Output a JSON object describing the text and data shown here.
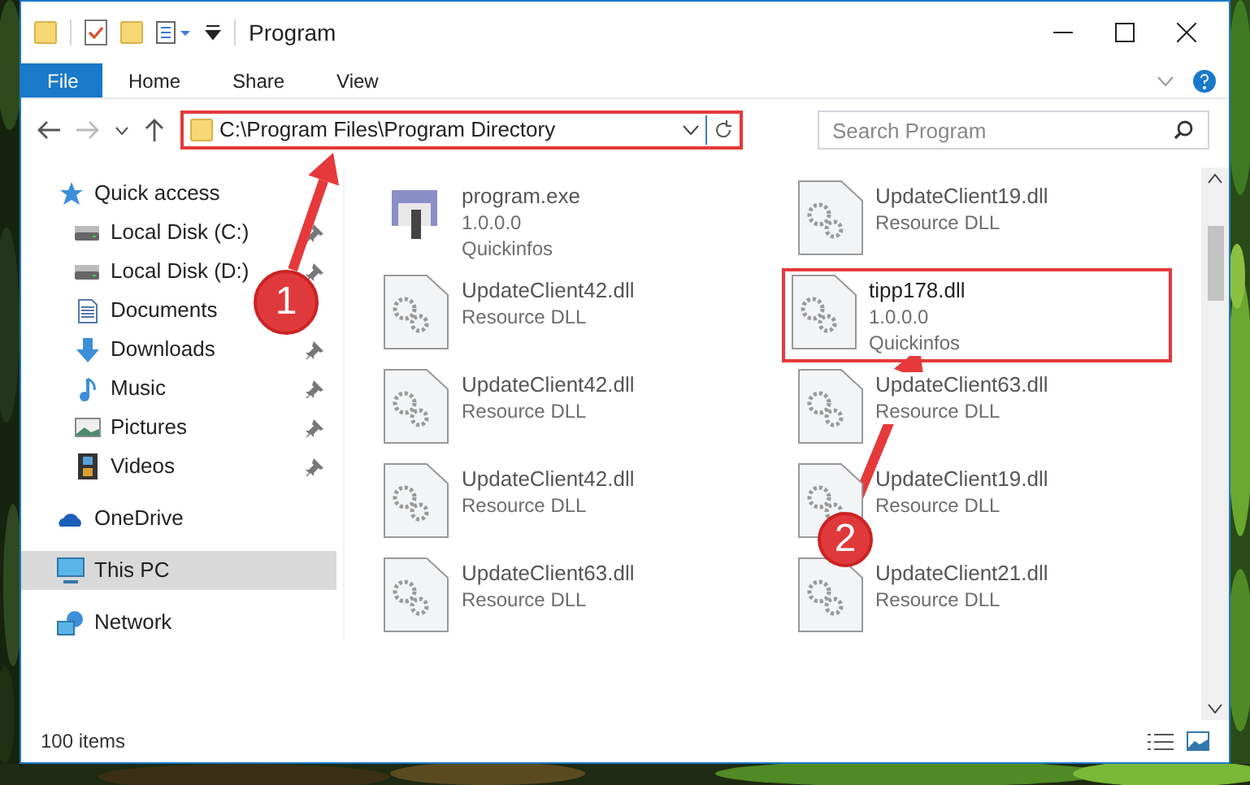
{
  "window": {
    "title": "Program"
  },
  "ribbon_tabs": [
    {
      "label": "File",
      "selected": true
    },
    {
      "label": "Home",
      "selected": false
    },
    {
      "label": "Share",
      "selected": false
    },
    {
      "label": "View",
      "selected": false
    }
  ],
  "address": {
    "path": "C:\\Program Files\\Program Directory",
    "marked": true
  },
  "search": {
    "placeholder": "Search Program"
  },
  "nav": [
    {
      "label": "Quick access",
      "selected": false,
      "children": [
        {
          "label": "Local Disk (C:)",
          "pinned": true
        },
        {
          "label": "Local Disk (D:)",
          "pinned": true
        },
        {
          "label": "Documents",
          "pinned": false
        },
        {
          "label": "Downloads",
          "pinned": true
        },
        {
          "label": "Music",
          "pinned": true
        },
        {
          "label": "Pictures",
          "pinned": true
        },
        {
          "label": "Videos",
          "pinned": true
        }
      ]
    },
    {
      "label": "OneDrive",
      "selected": false
    },
    {
      "label": "This PC",
      "selected": true
    },
    {
      "label": "Network",
      "selected": false
    }
  ],
  "files": [
    {
      "name": "program.exe",
      "details": [
        "1.0.0.0",
        "Quickinfos"
      ],
      "kind": "program",
      "marked": false
    },
    {
      "name": "UpdateClient19.dll",
      "details": [
        "Resource DLL"
      ],
      "kind": "library",
      "marked": false
    },
    {
      "name": "UpdateClient42.dll",
      "details": [
        "Resource DLL"
      ],
      "kind": "library",
      "marked": false
    },
    {
      "name": "tipp178.dll",
      "details": [
        "1.0.0.0",
        "Quickinfos"
      ],
      "kind": "library",
      "marked": true
    },
    {
      "name": "UpdateClient42.dll",
      "details": [
        "Resource DLL"
      ],
      "kind": "library",
      "marked": false
    },
    {
      "name": "UpdateClient63.dll",
      "details": [
        "Resource DLL"
      ],
      "kind": "library",
      "marked": false
    },
    {
      "name": "UpdateClient42.dll",
      "details": [
        "Resource DLL"
      ],
      "kind": "library",
      "marked": false
    },
    {
      "name": "UpdateClient19.dll",
      "details": [
        "Resource DLL"
      ],
      "kind": "library",
      "marked": false
    },
    {
      "name": "UpdateClient63.dll",
      "details": [
        "Resource DLL"
      ],
      "kind": "library",
      "marked": false
    },
    {
      "name": "UpdateClient21.dll",
      "details": [
        "Resource DLL"
      ],
      "kind": "library",
      "marked": false
    }
  ],
  "status_bar": {
    "count": "100 items"
  },
  "callouts": [
    {
      "number": "1"
    },
    {
      "number": "2"
    }
  ]
}
